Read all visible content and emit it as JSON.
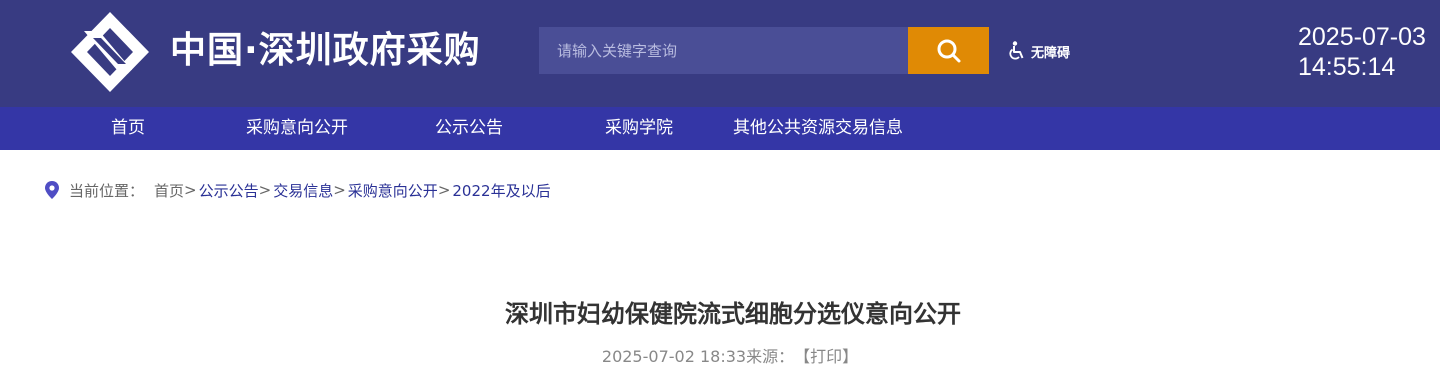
{
  "header": {
    "logo_icon": "shenzhen-procurement-logo",
    "site_title": "中国·深圳政府采购",
    "search": {
      "placeholder": "请输入关键字查询",
      "value": "",
      "button_icon": "search-icon"
    },
    "accessibility": {
      "icon": "wheelchair-icon",
      "label": "无障碍"
    },
    "clock": {
      "date": "2025-07-03",
      "time": "14:55:14"
    }
  },
  "nav": {
    "items": [
      {
        "label": "首页"
      },
      {
        "label": "采购意向公开"
      },
      {
        "label": "公示公告"
      },
      {
        "label": "采购学院"
      },
      {
        "label": "其他公共资源交易信息"
      }
    ]
  },
  "breadcrumb": {
    "icon": "location-pin-icon",
    "prefix": "当前位置：",
    "items": [
      {
        "label": "首页"
      },
      {
        "label": "公示公告"
      },
      {
        "label": "交易信息"
      },
      {
        "label": "采购意向公开"
      },
      {
        "label": "2022年及以后"
      }
    ],
    "separator": ">"
  },
  "article": {
    "title": "深圳市妇幼保健院流式细胞分选仪意向公开",
    "datetime": "2025-07-02 18:33",
    "source_label": "来源：",
    "print_label": "【打印】"
  },
  "colors": {
    "header_bg": "#383b82",
    "nav_bg": "#3436a6",
    "search_button": "#e08a05",
    "link": "#2a3196",
    "icon_purple": "#4f4dc4"
  }
}
